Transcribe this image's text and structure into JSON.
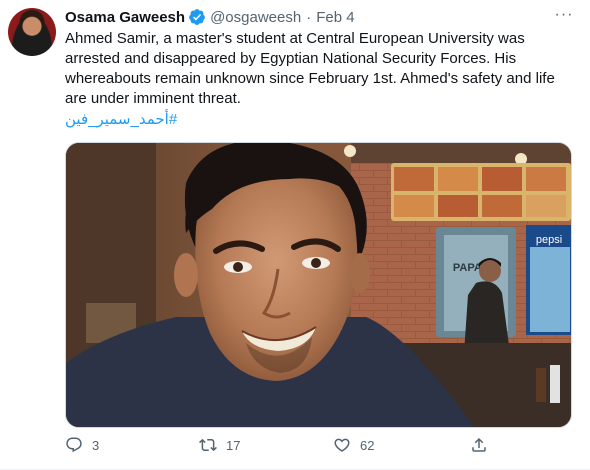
{
  "tweet": {
    "author_name": "Osama Gaweesh",
    "handle": "@osgaweesh",
    "separator": "·",
    "date": "Feb 4",
    "text": "Ahmed Samir, a master's student at Central European University was arrested and disappeared by Egyptian National Security Forces. His whereabouts remain unknown since February 1st. Ahmed's safety and life are under imminent threat.",
    "hashtag": "#أحمد_سمير_فين",
    "more_icon": "···"
  },
  "photo": {
    "sign_pepsi": "pepsi",
    "sign_papa": "PAPA JO"
  },
  "actions": {
    "replies": "3",
    "retweets": "17",
    "likes": "62"
  },
  "colors": {
    "accent": "#1d9bf0",
    "secondary_text": "#536471",
    "primary_text": "#0f1419"
  }
}
